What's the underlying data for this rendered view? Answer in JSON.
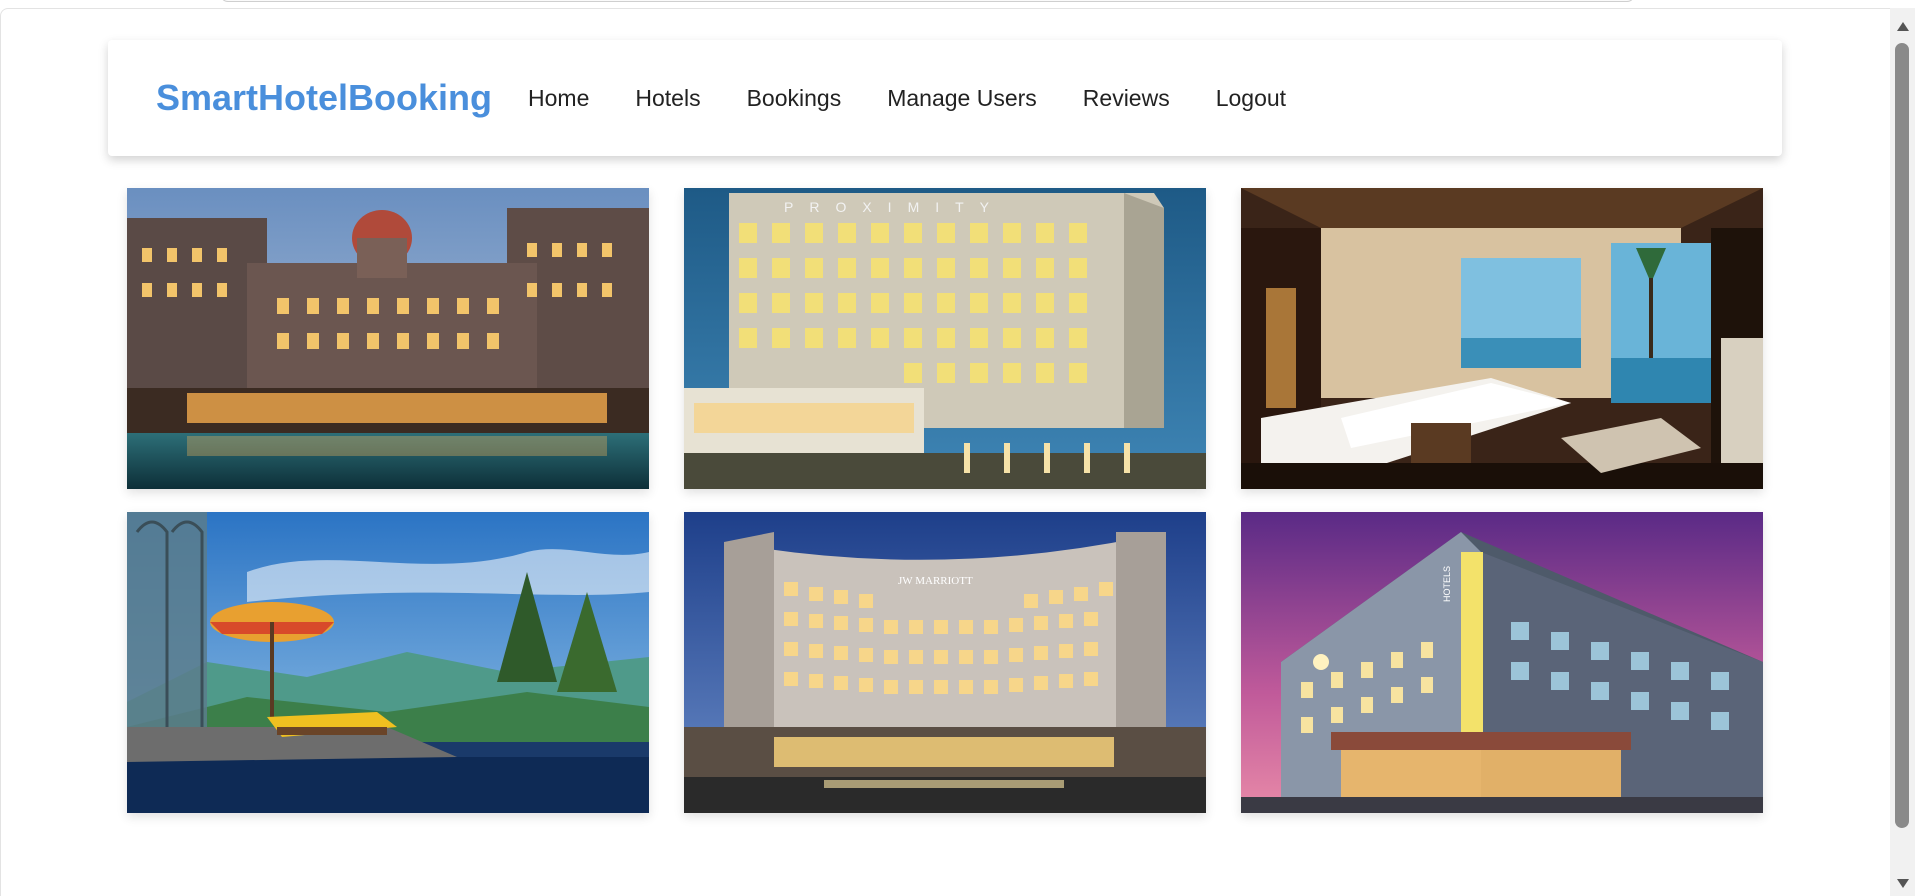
{
  "brand": "SmartHotelBooking",
  "nav": {
    "items": [
      "Home",
      "Hotels",
      "Bookings",
      "Manage Users",
      "Reviews",
      "Logout"
    ]
  },
  "gallery": {
    "hotels": [
      {
        "icon": "heritage-palace-hotel-photo"
      },
      {
        "icon": "proximity-hotel-photo",
        "sign": "PROXIMITY"
      },
      {
        "icon": "resort-bedroom-photo"
      },
      {
        "icon": "mountain-pool-terrace-photo"
      },
      {
        "icon": "jw-marriott-hotel-photo",
        "sign": "JW MARRIOTT"
      },
      {
        "icon": "modern-hotel-dusk-photo",
        "sign": "HOTELS"
      }
    ]
  },
  "colors": {
    "brand": "#4a8fdc",
    "nav_text": "#222222",
    "background": "#ffffff"
  }
}
